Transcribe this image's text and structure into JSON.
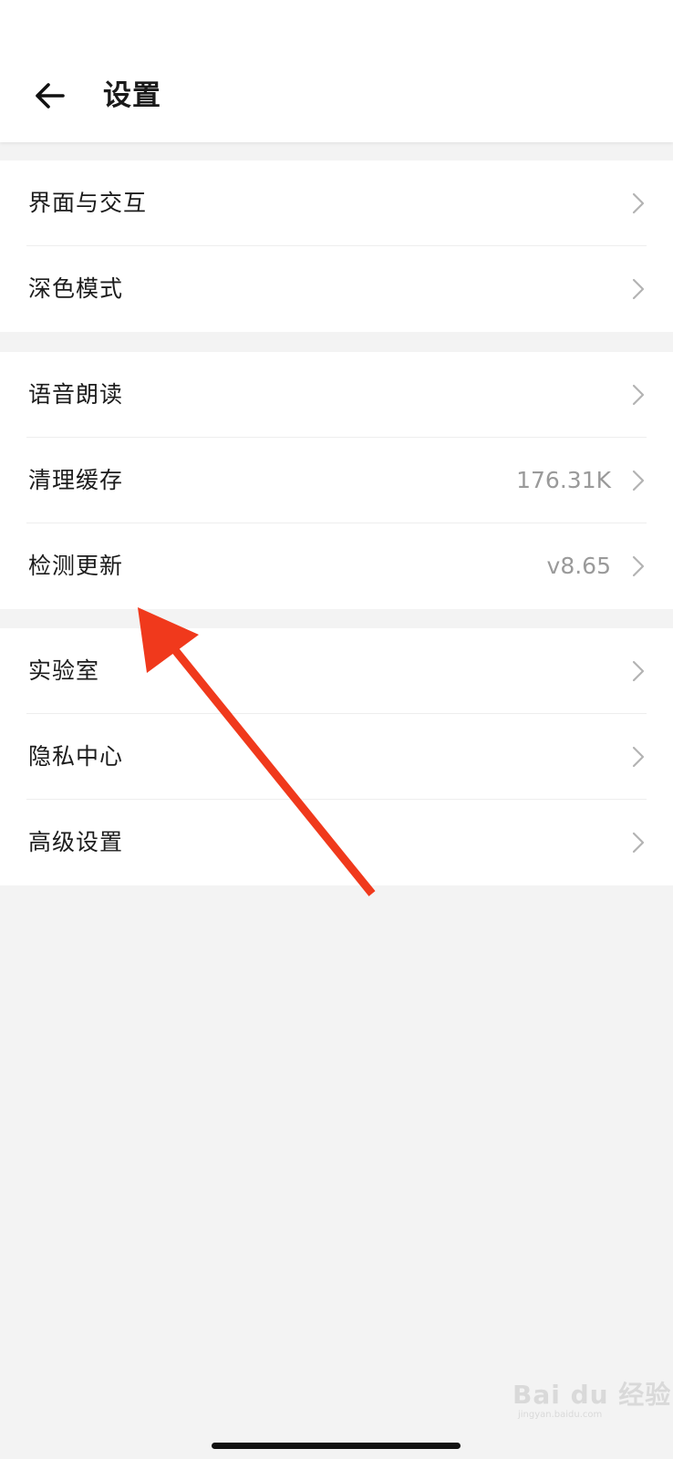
{
  "header": {
    "title": "设置",
    "back_icon": "arrow-left-icon"
  },
  "groups": [
    {
      "items": [
        {
          "label": "界面与交互",
          "value": ""
        },
        {
          "label": "深色模式",
          "value": ""
        }
      ]
    },
    {
      "items": [
        {
          "label": "语音朗读",
          "value": ""
        },
        {
          "label": "清理缓存",
          "value": "176.31K"
        },
        {
          "label": "检测更新",
          "value": "v8.65"
        }
      ]
    },
    {
      "items": [
        {
          "label": "实验室",
          "value": ""
        },
        {
          "label": "隐私中心",
          "value": ""
        },
        {
          "label": "高级设置",
          "value": ""
        }
      ]
    }
  ],
  "annotation": {
    "color": "#f0391c"
  },
  "watermark": {
    "text": "Bai du 经验",
    "sub": "jingyan.baidu.com"
  }
}
